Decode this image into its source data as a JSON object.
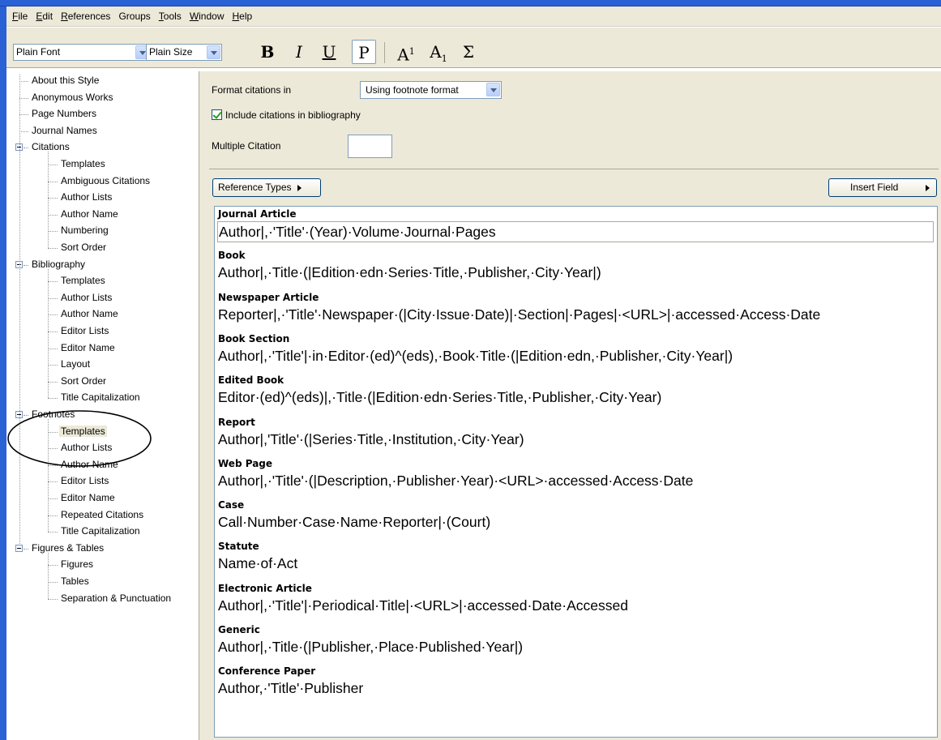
{
  "menu": [
    "File",
    "Edit",
    "References",
    "Groups",
    "Tools",
    "Window",
    "Help"
  ],
  "menu_mnemonic_index": [
    0,
    0,
    0,
    -1,
    0,
    0,
    0
  ],
  "toolbar": {
    "font_value": "Plain Font",
    "size_value": "Plain Size",
    "bold": "B",
    "italic": "I",
    "underline": "U",
    "plain": "P",
    "superscript_base": "A",
    "superscript_mark": "1",
    "subscript_base": "A",
    "subscript_mark": "1",
    "symbol": "Σ"
  },
  "tree": [
    {
      "label": "About this Style",
      "level": 0
    },
    {
      "label": "Anonymous Works",
      "level": 0
    },
    {
      "label": "Page Numbers",
      "level": 0
    },
    {
      "label": "Journal Names",
      "level": 0
    },
    {
      "label": "Citations",
      "level": 0,
      "expanded": true
    },
    {
      "label": "Templates",
      "level": 1
    },
    {
      "label": "Ambiguous Citations",
      "level": 1
    },
    {
      "label": "Author Lists",
      "level": 1
    },
    {
      "label": "Author Name",
      "level": 1
    },
    {
      "label": "Numbering",
      "level": 1
    },
    {
      "label": "Sort Order",
      "level": 1
    },
    {
      "label": "Bibliography",
      "level": 0,
      "expanded": true
    },
    {
      "label": "Templates",
      "level": 1
    },
    {
      "label": "Author Lists",
      "level": 1
    },
    {
      "label": "Author Name",
      "level": 1
    },
    {
      "label": "Editor Lists",
      "level": 1
    },
    {
      "label": "Editor Name",
      "level": 1
    },
    {
      "label": "Layout",
      "level": 1
    },
    {
      "label": "Sort Order",
      "level": 1
    },
    {
      "label": "Title Capitalization",
      "level": 1
    },
    {
      "label": "Footnotes",
      "level": 0,
      "expanded": true
    },
    {
      "label": "Templates",
      "level": 1,
      "selected": true
    },
    {
      "label": "Author Lists",
      "level": 1
    },
    {
      "label": "Author Name",
      "level": 1
    },
    {
      "label": "Editor Lists",
      "level": 1
    },
    {
      "label": "Editor Name",
      "level": 1
    },
    {
      "label": "Repeated Citations",
      "level": 1
    },
    {
      "label": "Title Capitalization",
      "level": 1
    },
    {
      "label": "Figures & Tables",
      "level": 0,
      "expanded": true
    },
    {
      "label": "Figures",
      "level": 1
    },
    {
      "label": "Tables",
      "level": 1
    },
    {
      "label": "Separation & Punctuation",
      "level": 1
    }
  ],
  "settings": {
    "format_label": "Format citations in",
    "format_value": "Using footnote format",
    "include_label": "Include citations in bibliography",
    "include_checked": true,
    "multiple_label": "Multiple Citation",
    "multiple_value": ""
  },
  "buttons": {
    "reference_types": "Reference Types",
    "insert_field": "Insert Field"
  },
  "templates": [
    {
      "type": "Journal Article",
      "template": "Author|,·'Title'·(Year)·Volume·Journal·Pages"
    },
    {
      "type": "Book",
      "template": "Author|,·Title·(|Edition·edn·Series·Title,·Publisher,·City·Year|)"
    },
    {
      "type": "Newspaper Article",
      "template": "Reporter|,·'Title'·Newspaper·(|City·Issue·Date)|·Section|·Pages|·<URL>|·accessed·Access·Date"
    },
    {
      "type": "Book Section",
      "template": "Author|,·'Title'|·in·Editor·(ed)^(eds),·Book·Title·(|Edition·edn,·Publisher,·City·Year|)"
    },
    {
      "type": "Edited Book",
      "template": "Editor·(ed)^(eds)|,·Title·(|Edition·edn·Series·Title,·Publisher,·City·Year)"
    },
    {
      "type": "Report",
      "template": "Author|,'Title'·(|Series·Title,·Institution,·City·Year)"
    },
    {
      "type": "Web Page",
      "template": "Author|,·'Title'·(|Description,·Publisher·Year)·<URL>·accessed·Access·Date"
    },
    {
      "type": "Case",
      "template": "Call·Number·Case·Name·Reporter|·(Court)"
    },
    {
      "type": "Statute",
      "template": "Name·of·Act"
    },
    {
      "type": "Electronic Article",
      "template": "Author|,·'Title'|·Periodical·Title|·<URL>|·accessed·Date·Accessed"
    },
    {
      "type": "Generic",
      "template": "Author|,·Title·(|Publisher,·Place·Published·Year|)"
    },
    {
      "type": "Conference Paper",
      "template": "Author,·'Title'·Publisher"
    }
  ],
  "colors": {
    "titlebar_blue": "#2a62d6",
    "face": "#ece9d8",
    "border_blue": "#7f9db9",
    "annotation": "#000000"
  }
}
